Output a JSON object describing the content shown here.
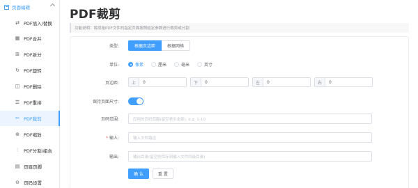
{
  "sidebar": {
    "group_label": "页面编辑",
    "items": [
      {
        "label": "PDF插入/替换",
        "icon": "swap-icon"
      },
      {
        "label": "PDF合并",
        "icon": "grid-icon"
      },
      {
        "label": "PDF拆分",
        "icon": "split-icon"
      },
      {
        "label": "PDF旋转",
        "icon": "rotate-icon"
      },
      {
        "label": "PDF删除",
        "icon": "trash-icon"
      },
      {
        "label": "PDF重排",
        "icon": "list-icon"
      },
      {
        "label": "PDF裁剪",
        "icon": "scissors-icon",
        "active": true
      },
      {
        "label": "PDF缩放",
        "icon": "zoom-icon"
      },
      {
        "label": "PDF分割/组合",
        "icon": "split-combine-icon"
      },
      {
        "label": "页眉页脚",
        "icon": "header-footer-icon"
      },
      {
        "label": "页码设置",
        "icon": "page-number-icon"
      }
    ]
  },
  "page": {
    "title": "PDF裁剪",
    "description": "功能说明：将原始PDF文件的指定页面按照给定参数进行裁剪或分割"
  },
  "form": {
    "type": {
      "label": "类型:",
      "options": [
        "根据页边距",
        "根据网格"
      ],
      "selected": "根据页边距"
    },
    "unit": {
      "label": "单位:",
      "options": [
        "像素",
        "厘米",
        "毫米",
        "英寸"
      ],
      "selected": "像素"
    },
    "margin": {
      "label": "页边距:",
      "fields": [
        {
          "prefix": "上",
          "value": "0"
        },
        {
          "prefix": "下",
          "value": "0"
        },
        {
          "prefix": "左",
          "value": "0"
        },
        {
          "prefix": "右",
          "value": "0"
        }
      ]
    },
    "keep_size": {
      "label": "保持页面尺寸:",
      "enabled": true
    },
    "page_range": {
      "label": "页码范围:",
      "placeholder": "应用的页码范围(留空表示全部), e.g. 1-10"
    },
    "input": {
      "label": "输入:",
      "required_mark": "*",
      "placeholder": "输入文件路径"
    },
    "output": {
      "label": "输出:",
      "placeholder": "输出目录(留空则保存到输入文件同级目录)"
    },
    "actions": {
      "confirm": "确 认",
      "reset": "重 置"
    }
  },
  "colors": {
    "accent": "#409eff",
    "required": "#f56c6c"
  }
}
